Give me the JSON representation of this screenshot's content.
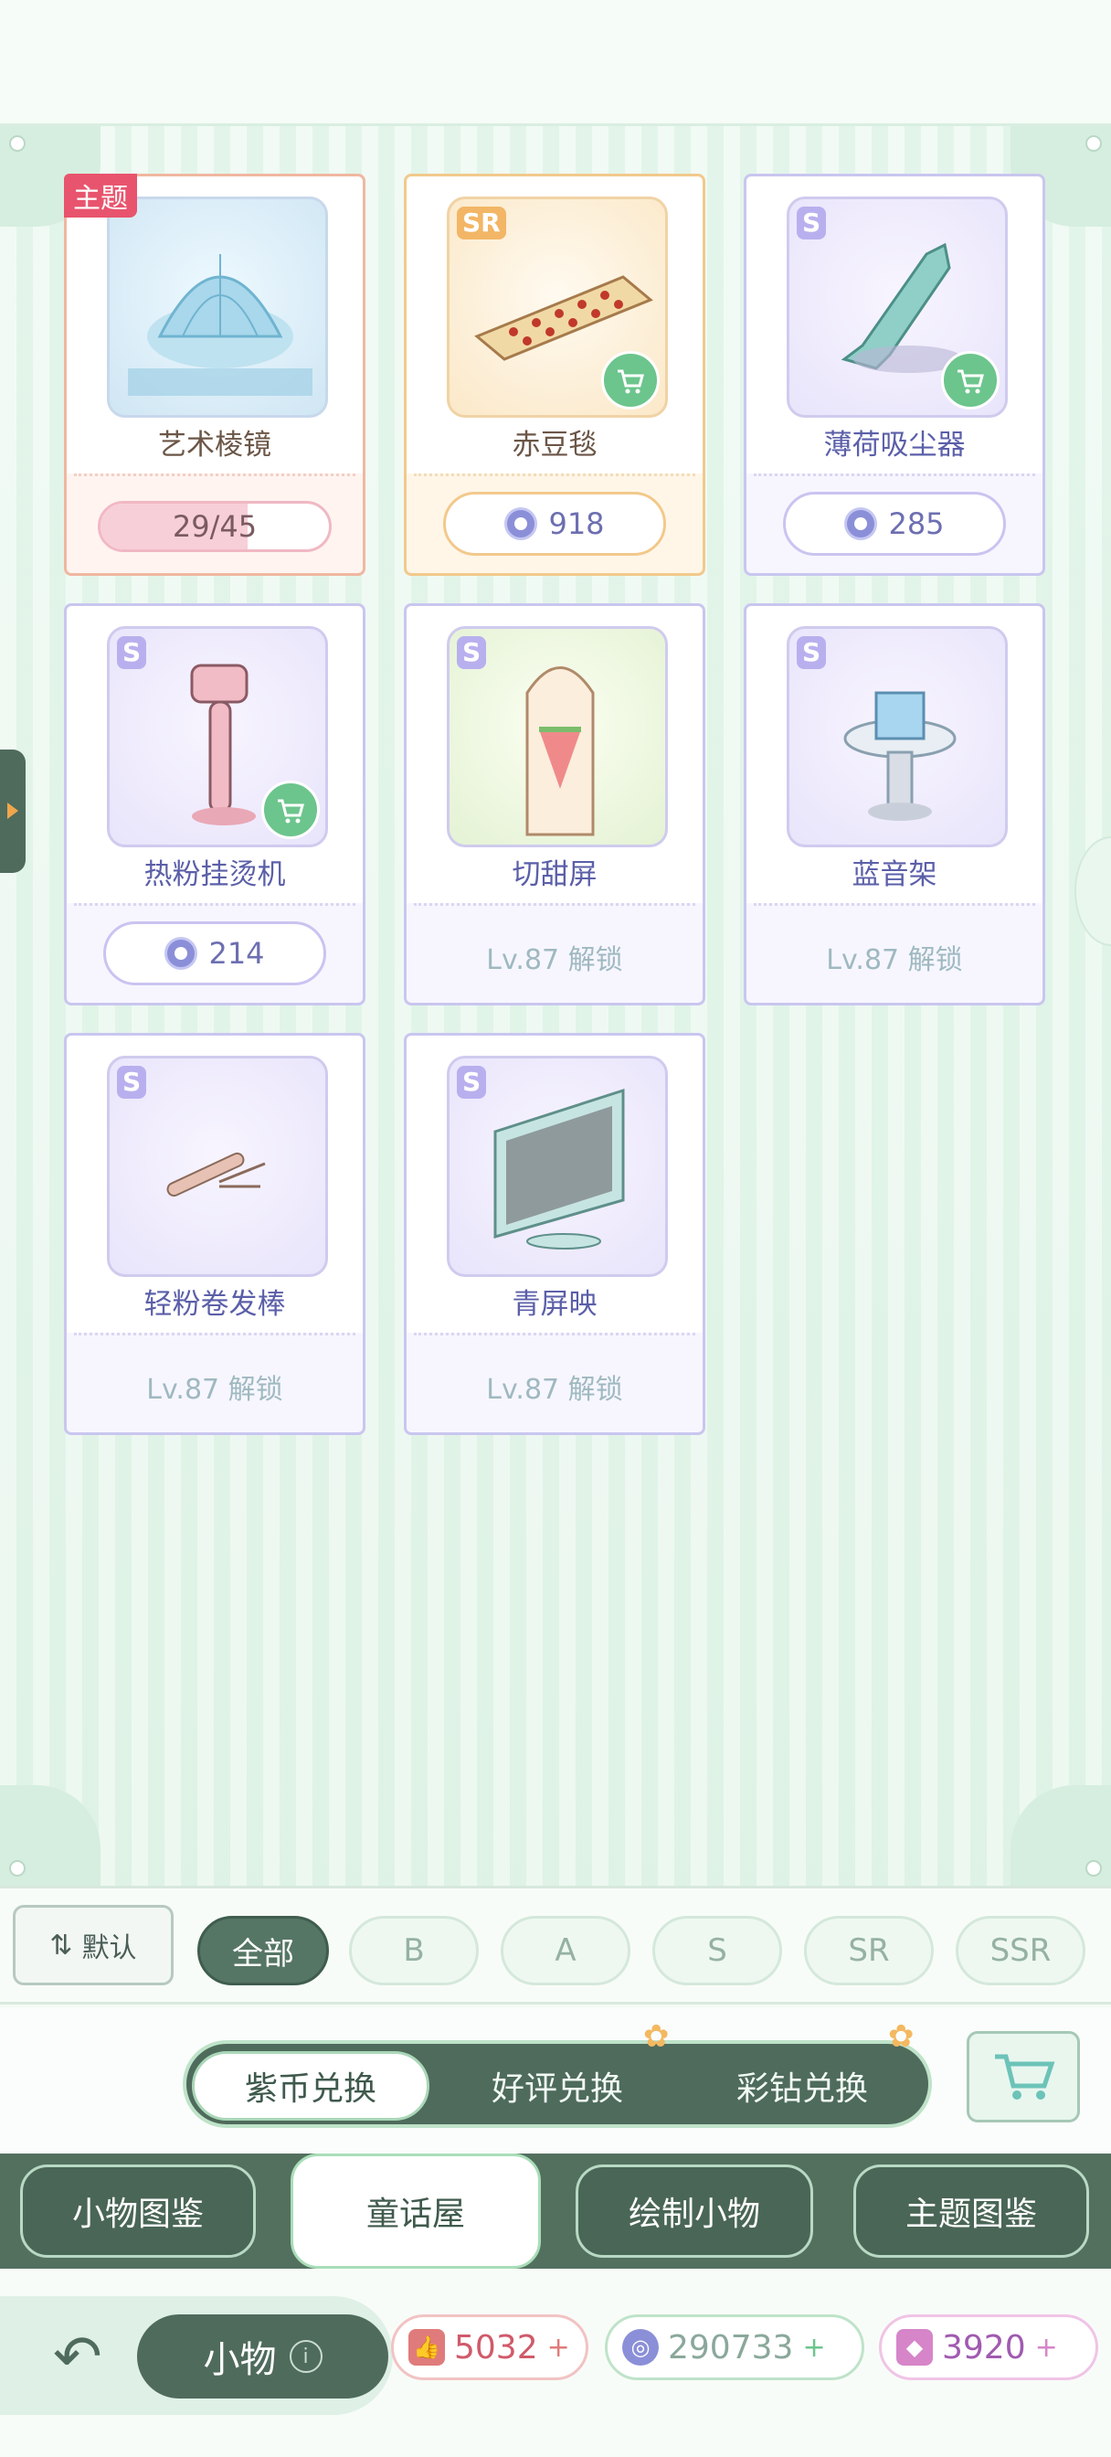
{
  "items": [
    {
      "name": "艺术棱镜",
      "tag": "主题",
      "rarity": "",
      "progress_text": "29/45",
      "progress": 0.644,
      "price": "",
      "lock": "",
      "cart": false
    },
    {
      "name": "赤豆毯",
      "tag": "",
      "rarity": "SR",
      "progress_text": "",
      "price": "918",
      "lock": "",
      "cart": true
    },
    {
      "name": "薄荷吸尘器",
      "tag": "",
      "rarity": "S",
      "progress_text": "",
      "price": "285",
      "lock": "",
      "cart": true
    },
    {
      "name": "热粉挂烫机",
      "tag": "",
      "rarity": "S",
      "progress_text": "",
      "price": "214",
      "lock": "",
      "cart": true
    },
    {
      "name": "切甜屏",
      "tag": "",
      "rarity": "S",
      "progress_text": "",
      "price": "",
      "lock": "Lv.87 解锁",
      "cart": false
    },
    {
      "name": "蓝音架",
      "tag": "",
      "rarity": "S",
      "progress_text": "",
      "price": "",
      "lock": "Lv.87 解锁",
      "cart": false
    },
    {
      "name": "轻粉卷发棒",
      "tag": "",
      "rarity": "S",
      "progress_text": "",
      "price": "",
      "lock": "Lv.87 解锁",
      "cart": false
    },
    {
      "name": "青屏映",
      "tag": "",
      "rarity": "S",
      "progress_text": "",
      "price": "",
      "lock": "Lv.87 解锁",
      "cart": false
    }
  ],
  "filter": {
    "sort_label": "默认",
    "chips": [
      "全部",
      "B",
      "A",
      "S",
      "SR",
      "SSR"
    ],
    "active_chip": "全部"
  },
  "exchange": {
    "tabs": [
      "紫币兑换",
      "好评兑换",
      "彩钻兑换"
    ],
    "active": "紫币兑换"
  },
  "categories": {
    "tabs": [
      "小物图鉴",
      "童话屋",
      "绘制小物",
      "主题图鉴"
    ],
    "active": "童话屋"
  },
  "bottom": {
    "title": "小物",
    "info_icon": "i",
    "currencies": [
      {
        "name": "好评",
        "value": "5032",
        "color": "#e07b7b"
      },
      {
        "name": "紫币",
        "value": "290733",
        "color": "#8b8fd8"
      },
      {
        "name": "彩钻",
        "value": "3920",
        "color": "#d685c9"
      }
    ]
  },
  "colors": {
    "accent_green": "#567665",
    "theme_tag": "#e8546d",
    "cart_green": "#6cc58c"
  }
}
